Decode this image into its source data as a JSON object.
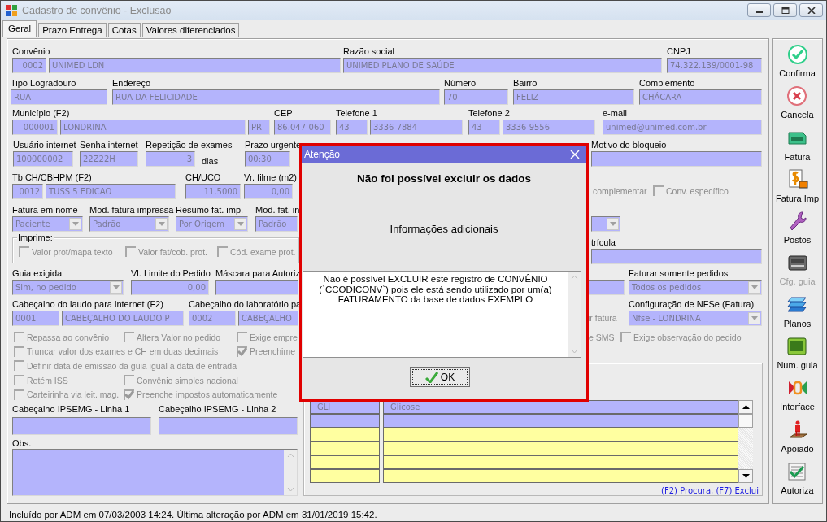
{
  "window": {
    "title": "Cadastro de convênio - Exclusão"
  },
  "tabs": [
    {
      "label": "Geral",
      "selected": true
    },
    {
      "label": "Prazo Entrega",
      "selected": false
    },
    {
      "label": "Cotas",
      "selected": false
    },
    {
      "label": "Valores diferenciados",
      "selected": false
    }
  ],
  "form": {
    "rows": [
      {
        "groups": [
          {
            "kind": "input",
            "label": "Convênio",
            "fields": [
              {
                "kind": "input",
                "value": "0002"
              },
              {
                "kind": "input",
                "value": "UNIMED LDN"
              }
            ]
          },
          {
            "kind": "input",
            "label": "Razão social",
            "fields": [
              {
                "kind": "input",
                "value": "UNIMED PLANO DE SAÚDE"
              }
            ]
          },
          {
            "kind": "input",
            "label": "CNPJ",
            "fields": [
              {
                "kind": "input",
                "value": "74.322.139/0001-98"
              }
            ]
          }
        ]
      },
      {
        "groups": [
          {
            "kind": "input",
            "label": "Tipo Logradouro",
            "fields": [
              {
                "kind": "input",
                "value": "RUA"
              }
            ]
          },
          {
            "kind": "input",
            "label": "Endereço",
            "fields": [
              {
                "kind": "input",
                "value": "RUA DA FELICIDADE"
              }
            ]
          },
          {
            "kind": "input",
            "label": "Número",
            "fields": [
              {
                "kind": "input",
                "value": "70"
              }
            ]
          },
          {
            "kind": "input",
            "label": "Bairro",
            "fields": [
              {
                "kind": "input",
                "value": "FELIZ"
              }
            ]
          },
          {
            "kind": "input",
            "label": "Complemento",
            "fields": [
              {
                "kind": "input",
                "value": "CHÁCARA"
              }
            ]
          }
        ]
      },
      {
        "groups": [
          {
            "kind": "input",
            "label": "Município (F2)",
            "fields": [
              {
                "kind": "input",
                "value": "000001"
              },
              {
                "kind": "input",
                "value": "LONDRINA"
              },
              {
                "kind": "input",
                "value": "PR"
              }
            ]
          },
          {
            "kind": "input",
            "label": "CEP",
            "fields": [
              {
                "kind": "input",
                "value": "86.047-060"
              }
            ]
          },
          {
            "kind": "input",
            "label": "Telefone 1",
            "fields": [
              {
                "kind": "input",
                "value": "43"
              },
              {
                "kind": "input",
                "value": "3336 7884"
              }
            ]
          },
          {
            "kind": "input",
            "label": "Telefone 2",
            "fields": [
              {
                "kind": "input",
                "value": "43"
              },
              {
                "kind": "input",
                "value": "3336 9556"
              }
            ]
          },
          {
            "kind": "input",
            "label": "e-mail",
            "fields": [
              {
                "kind": "input",
                "value": "unimed@unimed.com.br"
              }
            ]
          }
        ]
      },
      {
        "groups": [
          {
            "kind": "input",
            "label": "Usuário internet",
            "fields": [
              {
                "kind": "input",
                "value": "100000002"
              }
            ]
          },
          {
            "kind": "input",
            "label": "Senha internet",
            "fields": [
              {
                "kind": "input",
                "value": "22Z22H"
              }
            ]
          },
          {
            "kind": "input",
            "label": "Repetição de exames",
            "fields": [
              {
                "kind": "input",
                "value": "3"
              }
            ],
            "suffix": "dias"
          },
          {
            "kind": "input",
            "label": "Prazo urgente",
            "fields": [
              {
                "kind": "input",
                "value": "00:30"
              }
            ]
          },
          {
            "kind": "input",
            "label": "Motivo do bloqueio",
            "fields": [
              {
                "kind": "input"
              }
            ]
          }
        ]
      },
      {
        "groups": [
          {
            "kind": "input",
            "label": "Tb CH/CBHPM (F2)",
            "fields": [
              {
                "kind": "input",
                "value": "0012"
              },
              {
                "kind": "input",
                "value": "TUSS 5 EDICAO"
              }
            ]
          },
          {
            "kind": "input",
            "label": "CH/UCO",
            "fields": [
              {
                "kind": "input",
                "value": "11,5000"
              }
            ]
          },
          {
            "kind": "input",
            "label": "Vr. filme (m2)",
            "fields": [
              {
                "kind": "input",
                "value": "0,00"
              }
            ]
          },
          {
            "kind": "note",
            "label": "complementar"
          },
          {
            "kind": "checkbox",
            "label": "Conv. específico",
            "checked": false
          }
        ]
      },
      {
        "groups": [
          {
            "kind": "input",
            "label": "Fatura em nome",
            "fields": [
              {
                "kind": "select",
                "value": "Paciente"
              }
            ]
          },
          {
            "kind": "input",
            "label": "Mod. fatura impressa",
            "fields": [
              {
                "kind": "select",
                "value": "Padrão"
              }
            ]
          },
          {
            "kind": "input",
            "label": "Resumo fat. imp.",
            "fields": [
              {
                "kind": "select",
                "value": "Por Origem"
              }
            ]
          },
          {
            "kind": "input",
            "label": "Mod. fat. in",
            "fields": [
              {
                "kind": "input",
                "value": "Padrão"
              }
            ]
          },
          {
            "kind": "input",
            "fields": [
              {
                "kind": "select"
              }
            ]
          }
        ]
      },
      {
        "groups": [
          {
            "kind": "groupbox",
            "label": "Imprime:",
            "options": [
              {
                "label": "Valor prot/mapa texto",
                "checked": false
              },
              {
                "label": "Valor fat/cob. prot.",
                "checked": false
              },
              {
                "label": "Cód. exame prot.",
                "checked": false
              }
            ]
          },
          {
            "kind": "input",
            "label": "trícula",
            "fields": [
              {
                "kind": "input"
              }
            ]
          }
        ]
      },
      {
        "groups": [
          {
            "kind": "input",
            "label": "Guia exigida",
            "fields": [
              {
                "kind": "select",
                "value": "Sim, no pedido"
              }
            ]
          },
          {
            "kind": "input",
            "label": "Vl. Limite do Pedido",
            "fields": [
              {
                "kind": "input",
                "value": "0,00"
              }
            ]
          },
          {
            "kind": "input",
            "label": "Máscara para Autoriz",
            "fields": [
              {
                "kind": "input"
              }
            ]
          },
          {
            "kind": "input",
            "fields": [
              {
                "kind": "input"
              }
            ]
          },
          {
            "kind": "input",
            "label": "Faturar somente pedidos",
            "fields": [
              {
                "kind": "select",
                "value": "Todos os pedidos"
              }
            ]
          }
        ]
      },
      {
        "groups": [
          {
            "kind": "input",
            "label": "Cabeçalho do laudo para internet (F2)",
            "fields": [
              {
                "kind": "input",
                "value": "0001"
              },
              {
                "kind": "input",
                "value": "CABEÇALHO DO LAUDO P"
              }
            ]
          },
          {
            "kind": "input",
            "label": "Cabeçalho do laboratório pa",
            "fields": [
              {
                "kind": "input",
                "value": "0002"
              },
              {
                "kind": "input",
                "value": "CABEÇALHO"
              }
            ]
          },
          {
            "kind": "note",
            "label": "ir fatura"
          },
          {
            "kind": "input",
            "label": "Configuração de NFSe (Fatura)",
            "fields": [
              {
                "kind": "select",
                "value": "Nfse - LONDRINA"
              }
            ]
          }
        ]
      }
    ],
    "options": [
      {
        "items": [
          {
            "label": "Repassa ao convênio",
            "checked": false
          },
          {
            "label": "Altera Valor no pedido",
            "checked": false
          },
          {
            "label": "Exige empre",
            "checked": false
          }
        ]
      },
      {
        "items": [
          {
            "label": "Truncar valor dos exames e CH em duas decimais",
            "checked": false
          },
          {
            "label": "Preenchime",
            "checked": true
          }
        ]
      },
      {
        "items": [
          {
            "label": "Definir data de emissão da guia igual a data de entrada",
            "checked": false
          }
        ]
      },
      {
        "items": [
          {
            "label": "Retém ISS",
            "checked": false
          },
          {
            "label": "Convênio simples nacional",
            "checked": false
          }
        ]
      },
      {
        "items": [
          {
            "label": "Carteirinha via leit. mag.",
            "checked": false
          },
          {
            "label": "Preenche impostos automaticamente",
            "checked": true
          }
        ]
      }
    ],
    "right_options": [
      {
        "kind": "note",
        "label": "e SMS"
      },
      {
        "kind": "checkbox",
        "label": "Exige observação do pedido",
        "checked": false
      }
    ],
    "headers": [
      {
        "label": "Cabeçalho IPSEMG - Linha 1"
      },
      {
        "label": "Cabeçalho IPSEMG - Linha 2"
      }
    ],
    "obs": {
      "label": "Obs."
    }
  },
  "grid": {
    "rows": [
      {
        "selected": true,
        "cells": [
          "GLI",
          "Glicose"
        ]
      },
      {
        "selected": true
      },
      {
        "selected": false
      },
      {
        "selected": false
      },
      {
        "selected": false
      },
      {
        "selected": false
      }
    ],
    "hint": "(F2) Procura, (F7) Exclui"
  },
  "toolbar": [
    {
      "label": "Confirma",
      "disabled": false
    },
    {
      "label": "Cancela",
      "disabled": false
    },
    {
      "label": "Fatura",
      "disabled": false
    },
    {
      "label": "Fatura Imp",
      "disabled": false
    },
    {
      "label": "Postos",
      "disabled": false
    },
    {
      "label": "Cfg. guia",
      "disabled": true
    },
    {
      "label": "Planos",
      "disabled": false
    },
    {
      "label": "Num. guia",
      "disabled": false
    },
    {
      "label": "Interface",
      "disabled": false
    },
    {
      "label": "Apoiado",
      "disabled": false
    },
    {
      "label": "Autoriza",
      "disabled": false
    }
  ],
  "status_bar": "Incluído por ADM em 07/03/2003 14:24. Última alteração por ADM em 31/01/2019 15:42.",
  "dialog": {
    "title": "Atenção",
    "heading": "Não foi possível excluir os dados",
    "subheading": "Informações adicionais",
    "message": "Não é possível EXCLUIR este registro de CONVÊNIO (`CCODICONV`) pois ele está sendo utilizado por um(a) FATURAMENTO da base de dados EXEMPLO",
    "ok": "OK"
  }
}
